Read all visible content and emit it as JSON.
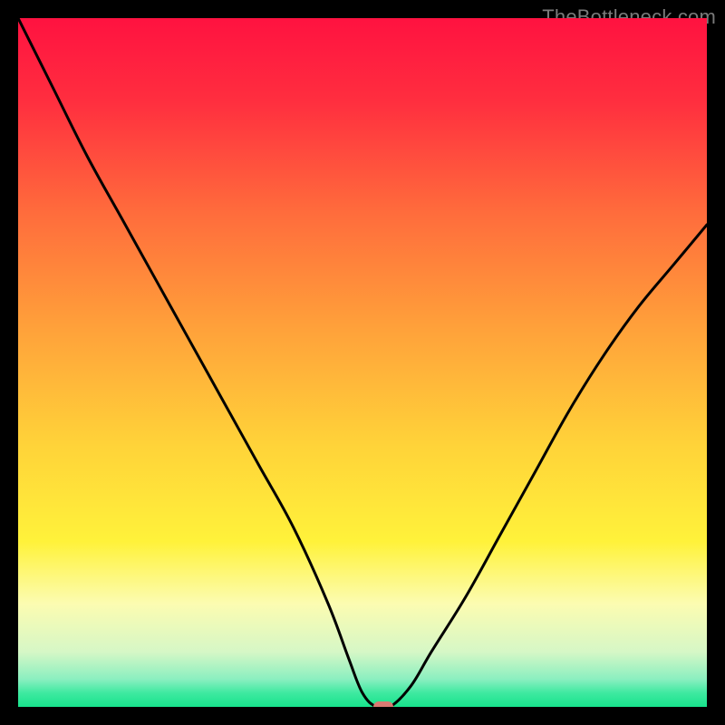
{
  "attribution": "TheBottleneck.com",
  "chart_data": {
    "type": "line",
    "title": "",
    "xlabel": "",
    "ylabel": "",
    "xlim": [
      0,
      100
    ],
    "ylim": [
      0,
      100
    ],
    "series": [
      {
        "name": "bottleneck-curve",
        "x": [
          0,
          5,
          10,
          15,
          20,
          25,
          30,
          35,
          40,
          45,
          48,
          50,
          52,
          54,
          57,
          60,
          65,
          70,
          75,
          80,
          85,
          90,
          95,
          100
        ],
        "values": [
          100,
          90,
          80,
          71,
          62,
          53,
          44,
          35,
          26,
          15,
          7,
          2,
          0,
          0,
          3,
          8,
          16,
          25,
          34,
          43,
          51,
          58,
          64,
          70
        ]
      }
    ],
    "optimal_point": {
      "x": 53,
      "y": 0
    },
    "gradient_stops": [
      {
        "offset": 0,
        "color": "#ff1240"
      },
      {
        "offset": 12,
        "color": "#ff2e3f"
      },
      {
        "offset": 28,
        "color": "#ff6b3c"
      },
      {
        "offset": 45,
        "color": "#ffa13a"
      },
      {
        "offset": 62,
        "color": "#ffd339"
      },
      {
        "offset": 76,
        "color": "#fff23a"
      },
      {
        "offset": 85,
        "color": "#fcfcb1"
      },
      {
        "offset": 92,
        "color": "#d6f7c6"
      },
      {
        "offset": 96,
        "color": "#8aefc0"
      },
      {
        "offset": 98,
        "color": "#3ee9a0"
      },
      {
        "offset": 100,
        "color": "#17e38c"
      }
    ]
  }
}
